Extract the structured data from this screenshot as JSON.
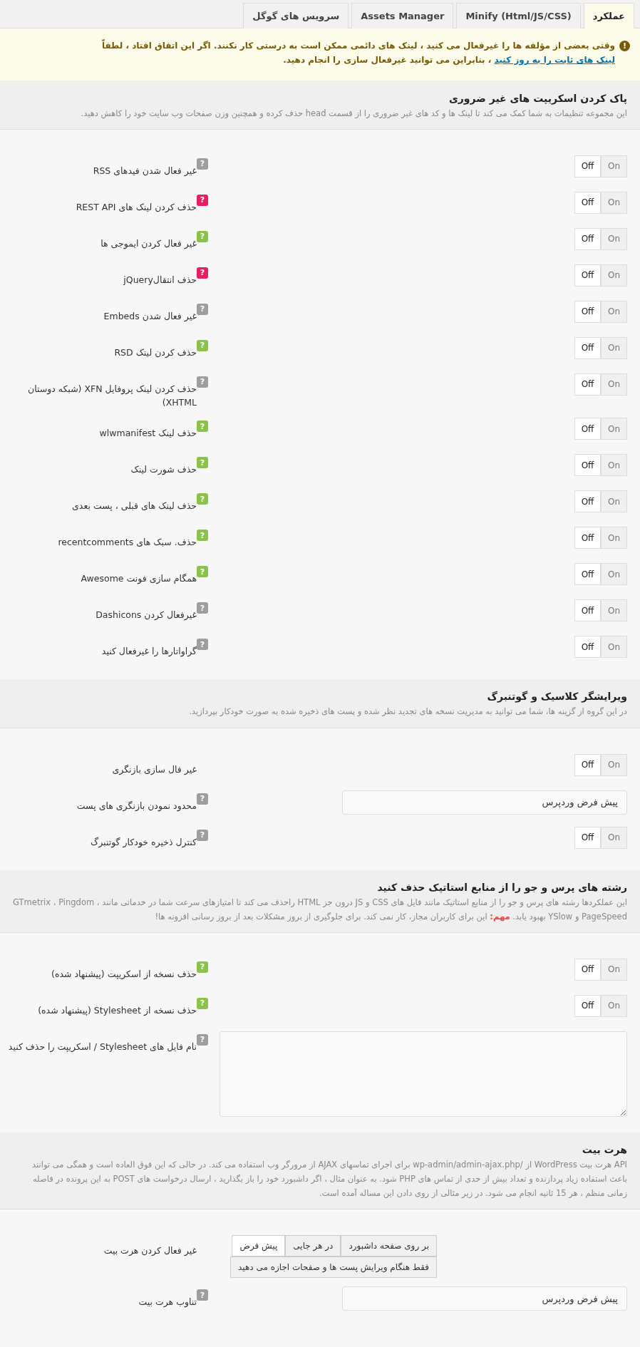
{
  "tabs": [
    {
      "label": "عملکرد",
      "selected": true
    },
    {
      "label": "Minify (Html/JS/CSS)",
      "selected": false
    },
    {
      "label": "Assets Manager",
      "selected": false
    },
    {
      "label": "سرویس های گوگل",
      "selected": false
    }
  ],
  "notice": {
    "icon": "!",
    "before": "وقتی بعضی از مؤلفه ها را غیرفعال می کنید ، لینک های دائمی ممکن است به درستی کار نکنند. اگر این اتفاق افتاد ، لطفاً ",
    "link": "لینک های ثابت را به روز کنید",
    "after": " ، بنابراین می توانید غیرفعال سازی را انجام دهید."
  },
  "sections": [
    {
      "title": "پاک کردن اسکریپت های غیر ضروری",
      "description": "این مجموعه تنظیمات به شما کمک می کند تا لینک ها و کد های غیر ضروری را از قسمت head حذف کرده و همچنین وزن صفحات وب سایت خود را کاهش دهید.",
      "rows": [
        {
          "kind": "toggle",
          "label": "غیر فعال شدن فیدهای RSS",
          "badge": {
            "text": "?",
            "color": "#9e9e9e"
          },
          "options": [
            {
              "label": "On",
              "selected": false
            },
            {
              "label": "Off",
              "selected": true
            }
          ]
        },
        {
          "kind": "toggle",
          "label": "حذف کردن لینک های REST API",
          "badge": {
            "text": "?",
            "color": "#e91e63"
          },
          "options": [
            {
              "label": "On",
              "selected": false
            },
            {
              "label": "Off",
              "selected": true
            }
          ]
        },
        {
          "kind": "toggle",
          "label": "غیر فعال کردن ایموجی ها",
          "badge": {
            "text": "?",
            "color": "#8bc34a"
          },
          "options": [
            {
              "label": "On",
              "selected": false
            },
            {
              "label": "Off",
              "selected": true
            }
          ]
        },
        {
          "kind": "toggle",
          "label": "حذف انتقالjQuery",
          "badge": {
            "text": "?",
            "color": "#e91e63"
          },
          "options": [
            {
              "label": "On",
              "selected": false
            },
            {
              "label": "Off",
              "selected": true
            }
          ]
        },
        {
          "kind": "toggle",
          "label": "غیر فعال شدن Embeds",
          "badge": {
            "text": "?",
            "color": "#9e9e9e"
          },
          "options": [
            {
              "label": "On",
              "selected": false
            },
            {
              "label": "Off",
              "selected": true
            }
          ]
        },
        {
          "kind": "toggle",
          "label": "حذف کردن لینک RSD",
          "badge": {
            "text": "?",
            "color": "#8bc34a"
          },
          "options": [
            {
              "label": "On",
              "selected": false
            },
            {
              "label": "Off",
              "selected": true
            }
          ]
        },
        {
          "kind": "toggle",
          "label": "حذف کردن لینک پروفایل XFN (شبکه دوستان XHTML)",
          "badge": {
            "text": "?",
            "color": "#9e9e9e"
          },
          "options": [
            {
              "label": "On",
              "selected": false
            },
            {
              "label": "Off",
              "selected": true
            }
          ]
        },
        {
          "kind": "toggle",
          "label": "حذف لینک wlwmanifest",
          "badge": {
            "text": "?",
            "color": "#8bc34a"
          },
          "options": [
            {
              "label": "On",
              "selected": false
            },
            {
              "label": "Off",
              "selected": true
            }
          ]
        },
        {
          "kind": "toggle",
          "label": "حذف شورت لینک",
          "badge": {
            "text": "?",
            "color": "#8bc34a"
          },
          "options": [
            {
              "label": "On",
              "selected": false
            },
            {
              "label": "Off",
              "selected": true
            }
          ]
        },
        {
          "kind": "toggle",
          "label": "حذف لینک های قبلی ، پست بعدی",
          "badge": {
            "text": "?",
            "color": "#8bc34a"
          },
          "options": [
            {
              "label": "On",
              "selected": false
            },
            {
              "label": "Off",
              "selected": true
            }
          ]
        },
        {
          "kind": "toggle",
          "label": "حذف. سبک های recentcomments",
          "badge": {
            "text": "?",
            "color": "#8bc34a"
          },
          "options": [
            {
              "label": "On",
              "selected": false
            },
            {
              "label": "Off",
              "selected": true
            }
          ]
        },
        {
          "kind": "toggle",
          "label": "همگام سازی فونت Awesome",
          "badge": {
            "text": "?",
            "color": "#8bc34a"
          },
          "options": [
            {
              "label": "On",
              "selected": false
            },
            {
              "label": "Off",
              "selected": true
            }
          ]
        },
        {
          "kind": "toggle",
          "label": "غیرفعال کردن Dashicons",
          "badge": {
            "text": "?",
            "color": "#9e9e9e"
          },
          "options": [
            {
              "label": "On",
              "selected": false
            },
            {
              "label": "Off",
              "selected": true
            }
          ]
        },
        {
          "kind": "toggle",
          "label": "گراواتارها را غیرفعال کنید",
          "badge": {
            "text": "?",
            "color": "#9e9e9e"
          },
          "options": [
            {
              "label": "On",
              "selected": false
            },
            {
              "label": "Off",
              "selected": true
            }
          ]
        }
      ]
    },
    {
      "title": "ویرایشگر کلاسیک و گوتنبرگ",
      "description": "در این گروه از گزینه ها، شما می توانید به مدیریت نسخه های تجدید نظر شده و پست های ذخیره شده به صورت خودکار بپردازید.",
      "rows": [
        {
          "kind": "toggle",
          "label": "غیر فال سازی بازنگری",
          "options": [
            {
              "label": "On",
              "selected": false
            },
            {
              "label": "Off",
              "selected": true
            }
          ]
        },
        {
          "kind": "input",
          "label": "محدود نمودن بازنگری های پست",
          "badge": {
            "text": "?",
            "color": "#9e9e9e"
          },
          "value": "پیش فرض وردپرس"
        },
        {
          "kind": "toggle",
          "label": "کنترل ذخیره خودکار گوتنبرگ",
          "badge": {
            "text": "?",
            "color": "#9e9e9e"
          },
          "options": [
            {
              "label": "On",
              "selected": false
            },
            {
              "label": "Off",
              "selected": true
            }
          ]
        }
      ]
    },
    {
      "title": "رشته های پرس و جو را از منابع استاتیک حذف کنید",
      "description": "این عملکردها رشته های پرس و جو را از منابع استاتیک مانند فایل های CSS و JS درون جز HTML راحذف می کند تا امتیازهای سرعت شما در خدماتی مانند ، GTmetrix ، Pingdom PageSpeed و YSlow بهبود یابد. **مهم:** این برای کاربران مجاز، کار نمی کند. برای جلوگیری از بروز مشکلات بعد از بروز رسانی افزونه ها!",
      "rows": [
        {
          "kind": "toggle",
          "label": "حذف نسخه از اسکریپت (پیشنهاد شده)",
          "badge": {
            "text": "?",
            "color": "#8bc34a"
          },
          "options": [
            {
              "label": "On",
              "selected": false
            },
            {
              "label": "Off",
              "selected": true
            }
          ]
        },
        {
          "kind": "toggle",
          "label": "حذف نسخه از Stylesheet (پیشنهاد شده)",
          "badge": {
            "text": "?",
            "color": "#8bc34a"
          },
          "options": [
            {
              "label": "On",
              "selected": false
            },
            {
              "label": "Off",
              "selected": true
            }
          ]
        },
        {
          "kind": "textarea",
          "label": "نام فایل های Stylesheet / اسکریپت را حذف کنید",
          "badge": {
            "text": "?",
            "color": "#9e9e9e"
          }
        }
      ]
    },
    {
      "title": "هرت بیت",
      "description": "API هرت بیت WordPress از /wp-admin/admin-ajax.php برای اجرای تماسهای AJAX از مرورگر وب استفاده می کند. در حالی که این فوق العاده است و همگی می توانند باعث استفاده زیاد پردازنده و تعداد بیش از حدی از تماس های PHP شود. به عنوان مثال ، اگر داشبورد خود را باز بگذارید ، ارسال درخواست های POST به این پرونده در فاصله زمانی منظم ، هر 15 ثانیه انجام می شود. در زیر مثالی از روی دادن این مساله آمده است.",
      "rows": [
        {
          "kind": "choice",
          "label": "غیر فعال کردن هرت بیت",
          "options": [
            {
              "label": "بر روی صفحه داشبورد",
              "selected": false
            },
            {
              "label": "در هر جایی",
              "selected": false
            },
            {
              "label": "پیش فرض",
              "selected": true
            },
            {
              "label": "فقط هنگام ویرایش پست ها و صفحات اجازه می دهید",
              "selected": false
            }
          ]
        },
        {
          "kind": "input",
          "label": "تناوب هرت بیت",
          "badge": {
            "text": "?",
            "color": "#9e9e9e"
          },
          "value": "پیش فرض وردپرس"
        }
      ]
    }
  ]
}
